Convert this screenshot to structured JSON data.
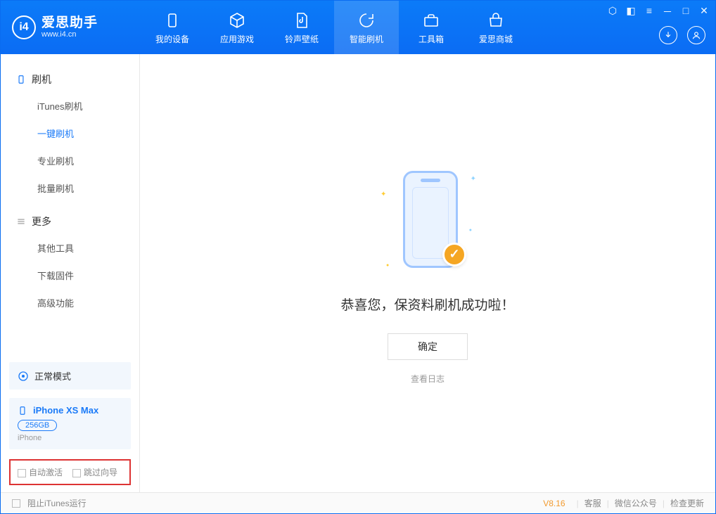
{
  "app": {
    "title": "爱思助手",
    "subtitle": "www.i4.cn"
  },
  "tabs": {
    "device": "我的设备",
    "apps": "应用游戏",
    "ringtone": "铃声壁纸",
    "flash": "智能刷机",
    "toolbox": "工具箱",
    "store": "爱思商城"
  },
  "sidebar": {
    "group_flash": "刷机",
    "itunes_flash": "iTunes刷机",
    "one_click_flash": "一键刷机",
    "pro_flash": "专业刷机",
    "batch_flash": "批量刷机",
    "group_more": "更多",
    "other_tools": "其他工具",
    "download_fw": "下载固件",
    "advanced": "高级功能"
  },
  "mode": {
    "label": "正常模式"
  },
  "device": {
    "name": "iPhone XS Max",
    "capacity": "256GB",
    "type": "iPhone"
  },
  "options": {
    "auto_activate": "自动激活",
    "skip_guide": "跳过向导"
  },
  "main": {
    "success": "恭喜您，保资料刷机成功啦！",
    "confirm": "确定",
    "view_log": "查看日志"
  },
  "footer": {
    "block_itunes": "阻止iTunes运行",
    "version": "V8.16",
    "service": "客服",
    "wechat": "微信公众号",
    "check_update": "检查更新"
  }
}
